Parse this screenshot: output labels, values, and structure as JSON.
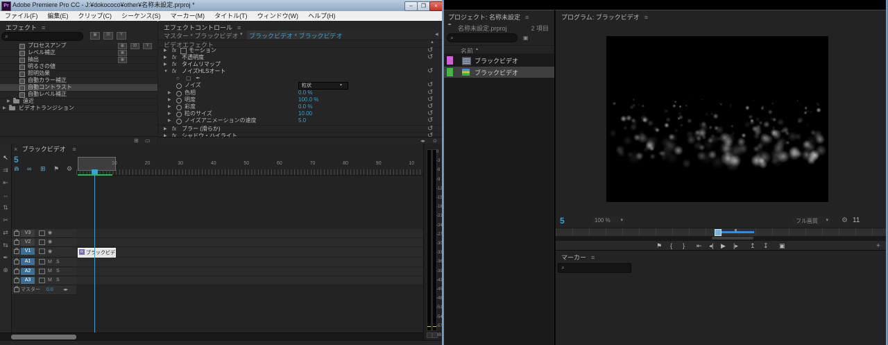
{
  "titlebar": {
    "app_icon": "Pr",
    "title": "Adobe Premiere Pro CC - J:¥dokococo¥other¥名称未設定.prproj *",
    "buttons": {
      "minimize": "–",
      "restore": "❐",
      "close": "×"
    }
  },
  "menubar": {
    "items": [
      "ファイル(F)",
      "編集(E)",
      "クリップ(C)",
      "シーケンス(S)",
      "マーカー(M)",
      "タイトル(T)",
      "ウィンドウ(W)",
      "ヘルプ(H)"
    ]
  },
  "effects_panel": {
    "title": "エフェクト",
    "search_placeholder": "",
    "items": [
      {
        "label": "プロセスアンプ",
        "badges": 3,
        "selected": false
      },
      {
        "label": "レベル補正",
        "badges": 1,
        "selected": false
      },
      {
        "label": "抽出",
        "badges": 1,
        "selected": false
      },
      {
        "label": "明るさの値",
        "badges": 0,
        "selected": false
      },
      {
        "label": "照明効果",
        "badges": 0,
        "selected": false
      },
      {
        "label": "自動カラー補正",
        "badges": 0,
        "selected": false
      },
      {
        "label": "自動コントラスト",
        "badges": 0,
        "selected": true
      },
      {
        "label": "自動レベル補正",
        "badges": 0,
        "selected": false
      }
    ],
    "folders": [
      {
        "label": "遠近",
        "indent": 1
      },
      {
        "label": "ビデオトランジション",
        "indent": 0
      }
    ],
    "badge_glyphs": [
      "▦",
      "32",
      "Y"
    ]
  },
  "effect_controls": {
    "title": "エフェクトコントロール",
    "tabs": [
      {
        "label": "マスター * ブラックビデオ",
        "active": false
      },
      {
        "label": "ブラックビデオ * ブラックビデオ",
        "active": true
      }
    ],
    "section": "ビデオエフェクト",
    "effects": [
      {
        "label": "モーション",
        "expanded": false,
        "reset": true,
        "motion_icon": true
      },
      {
        "label": "不透明度",
        "expanded": false,
        "reset": true,
        "motion_icon": false
      },
      {
        "label": "タイムリマップ",
        "expanded": false,
        "reset": false,
        "motion_icon": false
      },
      {
        "label": "ノイズHLSオート",
        "expanded": true,
        "reset": true,
        "motion_icon": false
      }
    ],
    "params": [
      {
        "label": "ノイズ",
        "value": "粒状",
        "kind": "dropdown"
      },
      {
        "label": "色相",
        "value": "0.0 %",
        "kind": "number"
      },
      {
        "label": "明度",
        "value": "100.0 %",
        "kind": "number"
      },
      {
        "label": "彩度",
        "value": "0.0 %",
        "kind": "number"
      },
      {
        "label": "粒のサイズ",
        "value": "10.00",
        "kind": "number"
      },
      {
        "label": "ノイズアニメーションの速度",
        "value": "5.0",
        "kind": "number"
      }
    ],
    "more_effects": [
      {
        "label": "ブラー (滑らか)",
        "reset": true
      },
      {
        "label": "シャドウ・ハイライト",
        "reset": true
      }
    ]
  },
  "timeline": {
    "tab": "ブラックビデオ",
    "timecode": "5",
    "toolbar": [
      {
        "name": "snap-icon",
        "glyph": "⋒",
        "active": true
      },
      {
        "name": "linked-selection-icon",
        "glyph": "∞",
        "active": true
      },
      {
        "name": "nest-icon",
        "glyph": "⊞",
        "active": true
      },
      {
        "name": "add-marker-icon",
        "glyph": "⚑",
        "active": false
      },
      {
        "name": "timeline-settings-icon",
        "glyph": "⚙",
        "active": false
      }
    ],
    "tools": [
      {
        "name": "selection-tool",
        "glyph": "↖",
        "active": true
      },
      {
        "name": "track-select-forward-tool",
        "glyph": "⇉",
        "active": false
      },
      {
        "name": "ripple-edit-tool",
        "glyph": "⇤",
        "active": false
      },
      {
        "name": "rolling-edit-tool",
        "glyph": "↔",
        "active": false
      },
      {
        "name": "rate-stretch-tool",
        "glyph": "⇅",
        "active": false
      },
      {
        "name": "razor-tool",
        "glyph": "✂",
        "active": false
      },
      {
        "name": "slip-tool",
        "glyph": "⇄",
        "active": false
      },
      {
        "name": "slide-tool",
        "glyph": "⇆",
        "active": false
      },
      {
        "name": "pen-tool",
        "glyph": "✒",
        "active": false
      },
      {
        "name": "zoom-tool",
        "glyph": "⊕",
        "active": false
      }
    ],
    "ruler_labels": [
      "10",
      "20",
      "30",
      "40",
      "50",
      "60",
      "70",
      "80",
      "90",
      "10"
    ],
    "video_tracks": [
      {
        "name": "V3",
        "targeted": false
      },
      {
        "name": "V2",
        "targeted": false
      },
      {
        "name": "V1",
        "targeted": true
      }
    ],
    "audio_tracks": [
      {
        "name": "A1",
        "targeted": true,
        "mute": "M",
        "solo": "S"
      },
      {
        "name": "A2",
        "targeted": true,
        "mute": "M",
        "solo": "S"
      },
      {
        "name": "A3",
        "targeted": true,
        "mute": "M",
        "solo": "S"
      }
    ],
    "master": {
      "label": "マスター",
      "value": "0.0"
    },
    "clip": {
      "label": "ブラックビデオ",
      "fx": "fx"
    }
  },
  "audio_meter": {
    "labels": [
      "0",
      "-3",
      "-6",
      "-9",
      "-12",
      "-15",
      "-18",
      "-21",
      "-24",
      "-27",
      "-30",
      "-33",
      "-36",
      "-39",
      "-42",
      "-45",
      "-48",
      "-51",
      "-54",
      "-57"
    ],
    "unit": "dB"
  },
  "project_panel": {
    "title": "プロジェクト: 名称未設定",
    "file": "名称未設定.prproj",
    "count": "2 項目",
    "name_column": "名前",
    "sort_caret": "▴",
    "items": [
      {
        "label": "ブラックビデオ",
        "color": "#cf5fd3",
        "type": "clip",
        "selected": false
      },
      {
        "label": "ブラックビデオ",
        "color": "#47b449",
        "type": "sequence",
        "selected": true
      }
    ]
  },
  "program_panel": {
    "title": "プログラム: ブラックビデオ",
    "timecode": "5",
    "zoom": "100 %",
    "quality": "フル画質",
    "duration": "11",
    "transport": [
      {
        "name": "add-marker-button",
        "glyph": "⚑"
      },
      {
        "name": "mark-in-button",
        "glyph": "{"
      },
      {
        "name": "mark-out-button",
        "glyph": "}"
      },
      {
        "name": "go-to-in-button",
        "glyph": "⇤"
      },
      {
        "name": "step-back-button",
        "glyph": "◂|"
      },
      {
        "name": "play-button",
        "glyph": "▶"
      },
      {
        "name": "step-forward-button",
        "glyph": "|▸"
      },
      {
        "name": "lift-button",
        "glyph": "↥"
      },
      {
        "name": "extract-button",
        "glyph": "↧"
      },
      {
        "name": "export-frame-button",
        "glyph": "▣"
      }
    ],
    "add_button": "+"
  },
  "markers_panel": {
    "title": "マーカー"
  },
  "icons": {
    "hamburger": "≡",
    "search": "⌕",
    "dropdown": "▾",
    "collapse": "▲",
    "close": "×",
    "wrench": "⚙",
    "reset": "↺",
    "pin": "◀",
    "keyframe_nav": "◂▸",
    "new_bin": "⊞",
    "delete": "▭",
    "mask_ellipse": "○",
    "mask_rect": "▢",
    "mask_pen": "✒"
  },
  "colors": {
    "accent_blue": "#2d8ceb",
    "text_blue": "#3f9fd0",
    "target_track": "#3c6f93",
    "render_green": "#17c24a",
    "clip_selected": "#e4e4e4",
    "label_pink": "#cf5fd3",
    "label_green": "#47b449"
  }
}
